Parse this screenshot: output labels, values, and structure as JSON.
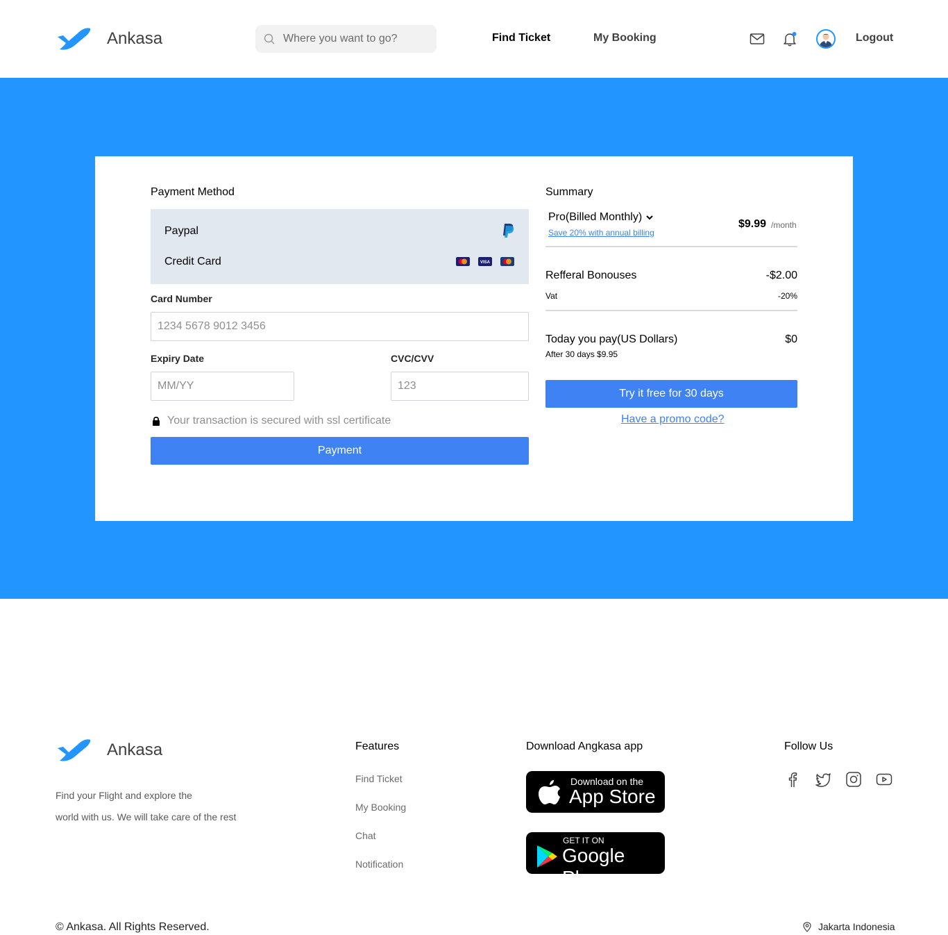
{
  "brand": {
    "name": "Ankasa",
    "color": "#2395ff"
  },
  "header": {
    "search_placeholder": "Where you want to go?",
    "nav": [
      {
        "label": "Find Ticket"
      },
      {
        "label": "My Booking"
      }
    ],
    "logout_label": "Logout",
    "icons": [
      "mail-icon",
      "bell-icon",
      "avatar"
    ]
  },
  "payment": {
    "title": "Payment Method",
    "methods": [
      {
        "label": "Paypal",
        "icon": "paypal-icon"
      },
      {
        "label": "Credit Card",
        "icon": "credit-card-icons"
      }
    ],
    "card_number_label": "Card Number",
    "card_number_placeholder": "1234 5678 9012 3456",
    "expiry_label": "Expiry Date",
    "expiry_placeholder": "MM/YY",
    "cvc_label": "CVC/CVV",
    "cvc_placeholder": "123",
    "secure_text": "Your transaction is secured with ssl certificate",
    "pay_button": "Payment",
    "button_color": "#3f82f4"
  },
  "summary": {
    "title": "Summary",
    "plan": "Pro(Billed Monthly)",
    "save_link": "Save 20% with annual billing",
    "price": "$9.99",
    "period": "/month",
    "referral_label": "Refferal Bonouses",
    "referral_value": "-$2.00",
    "vat_label": "Vat",
    "vat_value": "-20%",
    "today_label": "Today you pay(US Dollars)",
    "today_value": "$0",
    "after_label": "After 30 days $9.95",
    "trial_button": "Try it free for 30 days",
    "promo_link": "Have a promo code?"
  },
  "footer": {
    "description_line1": "Find your Flight and explore the",
    "description_line2": "world with us. We will take care of the rest",
    "features_title": "Features",
    "features": [
      "Find Ticket",
      "My Booking",
      "Chat",
      "Notification"
    ],
    "download_title": "Download Angkasa app",
    "app_store_small": "Download on the",
    "app_store_big": "App Store",
    "google_play_small": "GET IT ON",
    "google_play_big": "Google Play",
    "follow_title": "Follow Us",
    "social": [
      "facebook-icon",
      "twitter-icon",
      "instagram-icon",
      "youtube-icon"
    ],
    "copyright": "© Ankasa. All Rights Reserved.",
    "location": "Jakarta Indonesia"
  }
}
